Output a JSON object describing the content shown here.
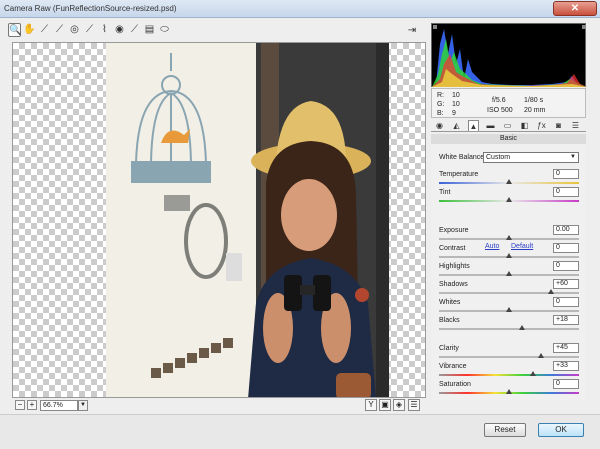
{
  "window": {
    "title": "Camera Raw (FunReflectionSource-resized.psd)",
    "close_glyph": "✕"
  },
  "toolbar": {
    "tools": [
      {
        "name": "zoom-tool",
        "glyph": "🔍",
        "active": true
      },
      {
        "name": "hand-tool",
        "glyph": "✋"
      },
      {
        "name": "white-balance-tool",
        "glyph": "⟋"
      },
      {
        "name": "color-sampler-tool",
        "glyph": "⟋"
      },
      {
        "name": "targeted-adjustment-tool",
        "glyph": "◎"
      },
      {
        "name": "straighten-tool",
        "glyph": "⟋"
      },
      {
        "name": "spot-removal-tool",
        "glyph": "⌇"
      },
      {
        "name": "red-eye-tool",
        "glyph": "◉"
      },
      {
        "name": "adjustment-brush-tool",
        "glyph": "⟋"
      },
      {
        "name": "graduated-filter-tool",
        "glyph": "▤"
      },
      {
        "name": "radial-filter-tool",
        "glyph": "⬭"
      }
    ],
    "toggle_fullscreen_glyph": "⇥"
  },
  "statusbar": {
    "zoom_out_glyph": "−",
    "zoom_in_glyph": "+",
    "zoom_value": "66.7%",
    "zoom_dropdown_glyph": "▼",
    "view_buttons": [
      "Y",
      "▣",
      "◈",
      "☰"
    ]
  },
  "readout": {
    "r_label": "R:",
    "r_value": "10",
    "g_label": "G:",
    "g_value": "10",
    "b_label": "B:",
    "b_value": "9",
    "aperture": "f/5.6",
    "shutter": "1/80 s",
    "iso": "ISO 500",
    "focal_length": "20 mm"
  },
  "panel_tabs": [
    "◉",
    "◭",
    "▲",
    "▬",
    "▭",
    "◧",
    "ƒx",
    "◙",
    "☰"
  ],
  "panel": {
    "name": "Basic",
    "white_balance_label": "White Balance:",
    "white_balance_value": "Custom",
    "white_balance_arrow": "▼",
    "auto_label": "Auto",
    "default_label": "Default",
    "sliders": [
      {
        "name": "temperature",
        "label": "Temperature",
        "value": "0",
        "position": 0.5,
        "track": "temp"
      },
      {
        "name": "tint",
        "label": "Tint",
        "value": "0",
        "position": 0.5,
        "track": "tint"
      },
      {
        "name": "exposure",
        "label": "Exposure",
        "value": "0.00",
        "position": 0.5
      },
      {
        "name": "contrast",
        "label": "Contrast",
        "value": "0",
        "position": 0.5
      },
      {
        "name": "highlights",
        "label": "Highlights",
        "value": "0",
        "position": 0.5
      },
      {
        "name": "shadows",
        "label": "Shadows",
        "value": "+60",
        "position": 0.8
      },
      {
        "name": "whites",
        "label": "Whites",
        "value": "0",
        "position": 0.5
      },
      {
        "name": "blacks",
        "label": "Blacks",
        "value": "+18",
        "position": 0.59
      },
      {
        "name": "clarity",
        "label": "Clarity",
        "value": "+45",
        "position": 0.73
      },
      {
        "name": "vibrance",
        "label": "Vibrance",
        "value": "+33",
        "position": 0.67,
        "track": "sat"
      },
      {
        "name": "saturation",
        "label": "Saturation",
        "value": "0",
        "position": 0.5,
        "track": "sat"
      }
    ]
  },
  "buttons": {
    "reset": "Reset",
    "ok": "OK"
  },
  "colors": {
    "title_bar": "#c6d6ea",
    "ok_border": "#3c7fb1",
    "link": "#2a3fc7"
  }
}
